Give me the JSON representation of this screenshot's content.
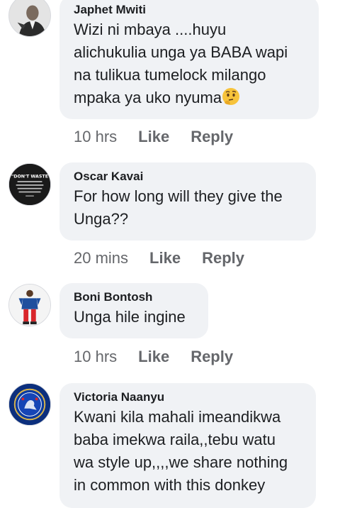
{
  "comments": [
    {
      "author": "Japhet Mwiti",
      "lines": [
        "Wizi ni mbaya ....huyu",
        "alichukulia unga ya BABA wapi",
        "na tulikua tumelock milango",
        "mpaka ya uko nyuma"
      ],
      "emoji": "thinking-face-emoji",
      "time": "10 hrs",
      "like_label": "Like",
      "reply_label": "Reply",
      "avatar": "man-in-suit-photo"
    },
    {
      "author": "Oscar Kavai",
      "lines": [
        "For how long will they give the",
        "Unga??"
      ],
      "time": "20 mins",
      "like_label": "Like",
      "reply_label": "Reply",
      "avatar": "dont-waste-quote-image",
      "avatar_text": "\"DON'T WASTE"
    },
    {
      "author": "Boni Bontosh",
      "lines": [
        "Unga hile ingine"
      ],
      "time": "10 hrs",
      "like_label": "Like",
      "reply_label": "Reply",
      "avatar": "person-standing-photo"
    },
    {
      "author": "Victoria Naanyu",
      "lines": [
        "Kwani kila mahali imeandikwa",
        "baba imekwa raila,,tebu watu",
        "wa style up,,,,we share nothing",
        "in common with this donkey"
      ],
      "avatar": "chelsea-crest-image"
    }
  ],
  "colors": {
    "bubble": "#f0f2f5",
    "meta": "#65676b",
    "text": "#1c1e21"
  }
}
